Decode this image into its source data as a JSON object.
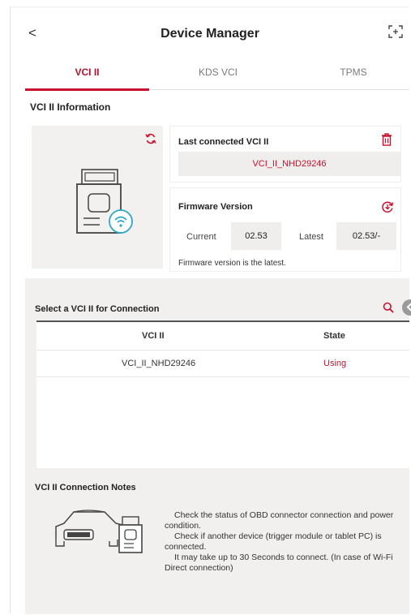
{
  "header": {
    "back_label": "<",
    "title": "Device Manager"
  },
  "tabs": [
    {
      "label": "VCI II"
    },
    {
      "label": "KDS VCI"
    },
    {
      "label": "TPMS"
    }
  ],
  "info": {
    "section_title": "VCI II Information",
    "last_connected_label": "Last connected VCI II",
    "last_connected_value": "VCI_II_NHD29246",
    "firmware_label": "Firmware Version",
    "current_label": "Current",
    "current_value": "02.53",
    "latest_label": "Latest",
    "latest_value": "02.53/-",
    "status_text": "Firmware version is the latest."
  },
  "connection": {
    "title": "Select a VCI II for Connection",
    "columns": [
      "VCI II",
      "State"
    ],
    "rows": [
      {
        "vci": "VCI_II_NHD29246",
        "state": "Using"
      }
    ]
  },
  "notes": {
    "title": "VCI II Connection Notes",
    "lines": [
      "Check the status of OBD connector connection and power condition.",
      "Check if another device (trigger module or tablet PC) is connected.",
      "It may take up to 30 Seconds to connect. (In case of Wi-Fi Direct connection)"
    ]
  },
  "icons": {
    "back": "chevron-left-icon",
    "expand": "fullscreen-icon",
    "refresh": "refresh-icon",
    "trash": "trash-icon",
    "update": "update-icon",
    "search": "search-icon",
    "device": "vci-device-icon",
    "car": "car-obd-icon"
  },
  "colors": {
    "accent": "#c8102e",
    "panel_bg": "#f2f0ee",
    "value_bg": "#efeeed"
  }
}
